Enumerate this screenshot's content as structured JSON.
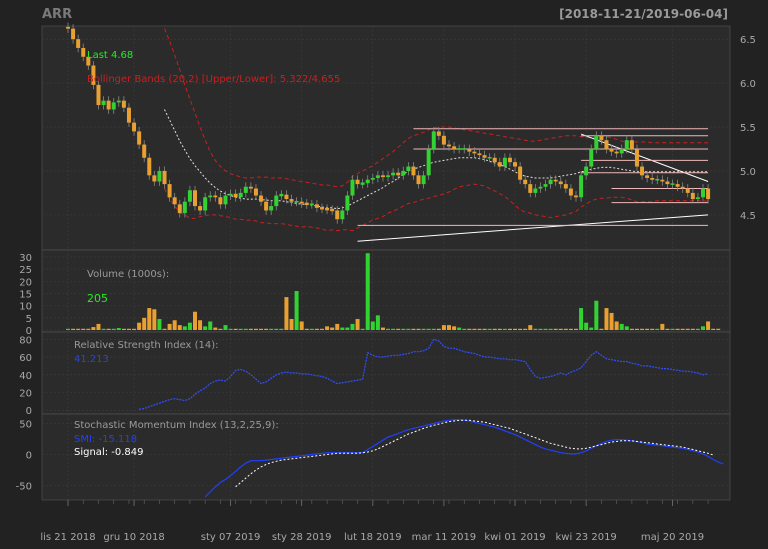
{
  "header": {
    "symbol": "ARR",
    "date_range": "[2018-11-21/2019-06-04]"
  },
  "colors": {
    "background": "#222222",
    "panel": "#2b2b2b",
    "grid": "#3c3c3c",
    "axis_text": "#a8a8a8",
    "candle_up": "#32d232",
    "candle_down": "#e8a030",
    "bollinger": "#cc1f1f",
    "sma": "#e0e0e0",
    "rsi": "#3050ff",
    "smi": "#2040ff",
    "signal": "#ffffff",
    "last_label": "#22ee22",
    "support_lines": "#f0b8b8"
  },
  "chart_data": [
    {
      "type": "candlestick",
      "panel": "price",
      "legend": {
        "last": "Last 4.68",
        "bollinger": "Bollinger Bands (20,2) [Upper/Lower]: 5.322/4.655"
      },
      "y_ticks": [
        "6.5",
        "6.0",
        "5.5",
        "5.0",
        "4.5"
      ],
      "ylim": [
        4.1,
        6.65
      ],
      "x_labels": [
        "lis 21 2018",
        "gru 10 2018",
        "sty 07 2019",
        "sty 28 2019",
        "lut 18 2019",
        "mar 11 2019",
        "kwi 01 2019",
        "kwi 23 2019",
        "maj 20 2019"
      ],
      "x_label_index": [
        0,
        13,
        32,
        46,
        60,
        74,
        88,
        102,
        119
      ],
      "closes": [
        6.62,
        6.5,
        6.4,
        6.3,
        6.2,
        5.98,
        5.75,
        5.8,
        5.7,
        5.78,
        5.8,
        5.72,
        5.55,
        5.45,
        5.3,
        5.15,
        4.95,
        4.88,
        5.0,
        4.85,
        4.7,
        4.62,
        4.52,
        4.65,
        4.78,
        4.6,
        4.55,
        4.7,
        4.72,
        4.7,
        4.62,
        4.72,
        4.74,
        4.7,
        4.75,
        4.82,
        4.8,
        4.72,
        4.65,
        4.55,
        4.6,
        4.72,
        4.73,
        4.68,
        4.65,
        4.65,
        4.63,
        4.62,
        4.62,
        4.58,
        4.57,
        4.56,
        4.55,
        4.45,
        4.55,
        4.72,
        4.9,
        4.85,
        4.86,
        4.9,
        4.92,
        4.95,
        4.93,
        4.95,
        4.98,
        4.95,
        5.0,
        5.05,
        4.95,
        4.85,
        4.95,
        5.25,
        5.45,
        5.4,
        5.3,
        5.28,
        5.25,
        5.25,
        5.25,
        5.22,
        5.2,
        5.18,
        5.15,
        5.15,
        5.1,
        5.05,
        5.15,
        5.1,
        5.05,
        4.9,
        4.85,
        4.75,
        4.8,
        4.82,
        4.85,
        4.9,
        4.88,
        4.85,
        4.8,
        4.72,
        4.7,
        4.95,
        5.05,
        5.25,
        5.4,
        5.35,
        5.25,
        5.22,
        5.2,
        5.25,
        5.35,
        5.25,
        5.05,
        4.95,
        4.92,
        4.9,
        4.9,
        4.88,
        4.85,
        4.85,
        4.82,
        4.8,
        4.75,
        4.68,
        4.7,
        4.8,
        4.68
      ],
      "bollinger_upper": [
        null,
        null,
        null,
        null,
        null,
        null,
        null,
        null,
        null,
        null,
        null,
        null,
        null,
        null,
        null,
        null,
        null,
        null,
        null,
        6.62,
        6.48,
        6.32,
        6.15,
        5.98,
        5.82,
        5.66,
        5.5,
        5.35,
        5.22,
        5.12,
        5.05,
        5.0,
        4.97,
        4.95,
        4.93,
        4.92,
        4.92,
        4.93,
        4.93,
        4.93,
        4.92,
        4.92,
        4.92,
        4.91,
        4.9,
        4.89,
        4.88,
        4.87,
        4.86,
        4.85,
        4.84,
        4.84,
        4.83,
        4.82,
        4.83,
        4.87,
        4.94,
        4.97,
        5.0,
        5.03,
        5.06,
        5.1,
        5.14,
        5.18,
        5.22,
        5.27,
        5.32,
        5.37,
        5.4,
        5.42,
        5.44,
        5.47,
        5.49,
        5.5,
        5.5,
        5.5,
        5.49,
        5.48,
        5.47,
        5.46,
        5.45,
        5.44,
        5.43,
        5.42,
        5.41,
        5.4,
        5.39,
        5.38,
        5.37,
        5.36,
        5.35,
        5.34,
        5.34,
        5.35,
        5.36,
        5.37,
        5.38,
        5.39,
        5.4,
        5.4,
        5.4,
        5.39,
        5.38,
        5.38,
        5.38,
        5.39,
        5.39,
        5.38,
        5.36,
        5.34,
        5.33,
        5.33,
        5.33,
        5.33,
        5.33,
        5.32,
        5.32,
        5.32,
        5.32,
        5.32,
        5.32,
        5.32,
        5.32,
        5.32,
        5.32,
        5.32,
        5.322
      ],
      "sma20": [
        null,
        null,
        null,
        null,
        null,
        null,
        null,
        null,
        null,
        null,
        null,
        null,
        null,
        null,
        null,
        null,
        null,
        null,
        null,
        5.7,
        5.58,
        5.46,
        5.34,
        5.24,
        5.14,
        5.06,
        4.99,
        4.92,
        4.86,
        4.81,
        4.77,
        4.74,
        4.72,
        4.7,
        4.69,
        4.68,
        4.68,
        4.68,
        4.67,
        4.67,
        4.66,
        4.66,
        4.66,
        4.65,
        4.64,
        4.63,
        4.62,
        4.62,
        4.61,
        4.6,
        4.59,
        4.58,
        4.58,
        4.57,
        4.58,
        4.6,
        4.63,
        4.66,
        4.69,
        4.72,
        4.75,
        4.78,
        4.81,
        4.85,
        4.88,
        4.92,
        4.96,
        5.0,
        5.02,
        5.04,
        5.06,
        5.08,
        5.1,
        5.11,
        5.12,
        5.13,
        5.14,
        5.15,
        5.15,
        5.15,
        5.15,
        5.14,
        5.13,
        5.11,
        5.09,
        5.07,
        5.05,
        5.02,
        4.99,
        4.96,
        4.94,
        4.93,
        4.92,
        4.92,
        4.92,
        4.92,
        4.93,
        4.94,
        4.95,
        4.96,
        4.97,
        4.99,
        5.0,
        5.02,
        5.03,
        5.04,
        5.04,
        5.04,
        5.03,
        5.02,
        5.01,
        5.0,
        4.99,
        4.99,
        4.99,
        4.99,
        4.99,
        4.99,
        4.99,
        4.99,
        4.99,
        4.99,
        4.99,
        4.99,
        4.99,
        4.99,
        4.99
      ],
      "bollinger_lower": [
        null,
        null,
        null,
        null,
        null,
        null,
        null,
        null,
        null,
        null,
        null,
        null,
        null,
        null,
        null,
        null,
        null,
        null,
        null,
        4.8,
        4.68,
        4.6,
        4.53,
        4.5,
        4.46,
        4.46,
        4.48,
        4.49,
        4.5,
        4.5,
        4.49,
        4.48,
        4.47,
        4.45,
        4.45,
        4.44,
        4.44,
        4.43,
        4.41,
        4.41,
        4.4,
        4.4,
        4.4,
        4.39,
        4.38,
        4.37,
        4.36,
        4.37,
        4.36,
        4.35,
        4.34,
        4.32,
        4.33,
        4.32,
        4.33,
        4.33,
        4.32,
        4.35,
        4.38,
        4.41,
        4.44,
        4.46,
        4.48,
        4.52,
        4.54,
        4.57,
        4.6,
        4.63,
        4.64,
        4.66,
        4.68,
        4.69,
        4.71,
        4.72,
        4.74,
        4.76,
        4.79,
        4.82,
        4.83,
        4.84,
        4.85,
        4.84,
        4.83,
        4.8,
        4.77,
        4.74,
        4.71,
        4.66,
        4.61,
        4.56,
        4.53,
        4.52,
        4.5,
        4.49,
        4.48,
        4.47,
        4.48,
        4.49,
        4.5,
        4.52,
        4.54,
        4.59,
        4.62,
        4.66,
        4.68,
        4.69,
        4.69,
        4.7,
        4.7,
        4.7,
        4.69,
        4.67,
        4.65,
        4.65,
        4.65,
        4.65,
        4.66,
        4.66,
        4.66,
        4.66,
        4.66,
        4.66,
        4.66,
        4.66,
        4.66,
        4.66,
        4.655
      ],
      "support_lines": [
        {
          "from": [
            57,
            4.2
          ],
          "to": [
            126,
            4.5
          ],
          "color": "#ffffff"
        },
        {
          "from": [
            57,
            4.38
          ],
          "to": [
            126,
            4.38
          ],
          "color": "#f0b8b8"
        },
        {
          "from": [
            101,
            5.42
          ],
          "to": [
            126,
            4.88
          ],
          "color": "#ffffff"
        },
        {
          "from": [
            68,
            5.48
          ],
          "to": [
            126,
            5.48
          ],
          "color": "#f0b8b8"
        },
        {
          "from": [
            101,
            5.4
          ],
          "to": [
            126,
            5.4
          ],
          "color": "#f0b8b8"
        },
        {
          "from": [
            68,
            5.25
          ],
          "to": [
            126,
            5.25
          ],
          "color": "#f0b8b8"
        },
        {
          "from": [
            101,
            5.12
          ],
          "to": [
            126,
            5.12
          ],
          "color": "#f0b8b8"
        },
        {
          "from": [
            101,
            4.98
          ],
          "to": [
            126,
            4.98
          ],
          "color": "#f0b8b8"
        },
        {
          "from": [
            107,
            4.8
          ],
          "to": [
            126,
            4.8
          ],
          "color": "#f0b8b8"
        },
        {
          "from": [
            107,
            4.64
          ],
          "to": [
            126,
            4.64
          ],
          "color": "#f0b8b8"
        }
      ]
    },
    {
      "type": "bar",
      "panel": "volume",
      "label": "Volume (1000s):",
      "last_value": "205",
      "y_ticks": [
        "30",
        "25",
        "20",
        "15",
        "10",
        "5",
        "0"
      ],
      "ylim": [
        0,
        32
      ],
      "values": [
        0.5,
        0.5,
        0.5,
        0.5,
        0.5,
        1.2,
        2.5,
        0.5,
        0.5,
        0.5,
        0.8,
        0.5,
        0.5,
        0.5,
        3.0,
        5.0,
        9.0,
        8.5,
        4.5,
        0.5,
        2.5,
        4.0,
        2.0,
        1.5,
        3.0,
        7.5,
        4.0,
        1.5,
        3.5,
        1.0,
        0.5,
        2.0,
        0.5,
        0.5,
        0.5,
        0.5,
        0.5,
        0.5,
        0.5,
        0.5,
        0.5,
        0.5,
        0.5,
        13.5,
        4.5,
        16.0,
        3.5,
        0.5,
        0.5,
        0.5,
        0.5,
        1.5,
        1.0,
        2.5,
        1.0,
        1.0,
        2.5,
        4.5,
        0.5,
        31.5,
        3.5,
        6.0,
        1.0,
        0.5,
        0.5,
        0.5,
        0.5,
        0.5,
        0.5,
        0.5,
        0.5,
        0.5,
        0.5,
        0.5,
        2.0,
        2.0,
        1.5,
        1.0,
        0.5,
        0.5,
        0.5,
        0.5,
        0.5,
        0.5,
        0.5,
        0.5,
        0.5,
        0.5,
        0.5,
        0.5,
        0.5,
        2.0,
        0.5,
        0.5,
        0.5,
        0.5,
        0.5,
        0.5,
        0.5,
        0.5,
        0.5,
        9.0,
        3.0,
        1.0,
        12.0,
        0.5,
        9.0,
        7.0,
        3.5,
        2.5,
        1.5,
        0.5,
        0.5,
        0.5,
        0.5,
        0.5,
        0.5,
        2.5,
        0.5,
        0.5,
        0.5,
        0.5,
        0.5,
        0.5,
        0.5,
        1.5,
        3.5,
        0.5,
        0.5
      ]
    },
    {
      "type": "line",
      "panel": "rsi",
      "label": "Relative Strength Index (14):",
      "last_value": "41.213",
      "y_ticks": [
        "80",
        "60",
        "40",
        "20",
        "0"
      ],
      "ylim": [
        -2,
        86
      ],
      "values": [
        null,
        null,
        null,
        null,
        null,
        null,
        null,
        null,
        null,
        null,
        null,
        null,
        null,
        null,
        1,
        2,
        4,
        6,
        8,
        10,
        12,
        13,
        12,
        11,
        13,
        18,
        22,
        25,
        30,
        33,
        34,
        33,
        38,
        45,
        46,
        44,
        40,
        35,
        30,
        32,
        36,
        40,
        42,
        43,
        42,
        42,
        41,
        41,
        40,
        39,
        38,
        36,
        33,
        30,
        31,
        32,
        33,
        34,
        35,
        65,
        62,
        60,
        60,
        61,
        62,
        62,
        63,
        64,
        66,
        66,
        67,
        70,
        80,
        78,
        72,
        70,
        70,
        68,
        66,
        65,
        64,
        62,
        60,
        60,
        59,
        58,
        58,
        57,
        57,
        56,
        55,
        46,
        38,
        36,
        37,
        38,
        40,
        42,
        40,
        43,
        45,
        48,
        55,
        62,
        66,
        62,
        58,
        57,
        56,
        55,
        55,
        53,
        52,
        50,
        50,
        49,
        48,
        47,
        47,
        46,
        45,
        44,
        44,
        43,
        42,
        40,
        41.2
      ]
    },
    {
      "type": "line",
      "panel": "smi",
      "label": "Stochastic Momentum Index (13,2,25,9):",
      "smi_label": "SMI: -15.118",
      "signal_label": "Signal: -0.849",
      "y_ticks": [
        "50",
        "0",
        "-50"
      ],
      "ylim": [
        -70,
        62
      ],
      "smi": [
        null,
        null,
        null,
        null,
        null,
        null,
        null,
        null,
        null,
        null,
        null,
        null,
        null,
        null,
        null,
        null,
        null,
        null,
        null,
        null,
        null,
        null,
        null,
        null,
        null,
        null,
        null,
        -68,
        -60,
        -52,
        -45,
        -40,
        -34,
        -27,
        -20,
        -14,
        -10,
        -10,
        -10,
        -9,
        -8,
        -7,
        -6,
        -5,
        -4,
        -3,
        -2,
        -1,
        0,
        1,
        2,
        3,
        3,
        3,
        3,
        3,
        3,
        3,
        3,
        8,
        13,
        18,
        23,
        28,
        31,
        34,
        37,
        40,
        42,
        44,
        46,
        48,
        50,
        52,
        54,
        55,
        56,
        56,
        55,
        54,
        52,
        50,
        48,
        46,
        44,
        41,
        38,
        35,
        32,
        28,
        24,
        20,
        16,
        12,
        9,
        7,
        5,
        3,
        2,
        1,
        1,
        3,
        6,
        10,
        14,
        18,
        21,
        23,
        24,
        24,
        23,
        22,
        21,
        19,
        17,
        16,
        15,
        14,
        13,
        12,
        11,
        10,
        8,
        6,
        4,
        1,
        -3,
        -8,
        -12,
        -15.1
      ],
      "signal": [
        null,
        null,
        null,
        null,
        null,
        null,
        null,
        null,
        null,
        null,
        null,
        null,
        null,
        null,
        null,
        null,
        null,
        null,
        null,
        null,
        null,
        null,
        null,
        null,
        null,
        null,
        null,
        null,
        null,
        null,
        null,
        null,
        null,
        -52,
        -45,
        -38,
        -31,
        -25,
        -20,
        -16,
        -13,
        -11,
        -9,
        -8,
        -7,
        -6,
        -5,
        -4,
        -3,
        -2,
        -1,
        0,
        1,
        2,
        2,
        2,
        2,
        2,
        3,
        4,
        6,
        9,
        13,
        17,
        21,
        25,
        29,
        33,
        36,
        39,
        42,
        45,
        47,
        49,
        51,
        53,
        54,
        55,
        55,
        55,
        54,
        53,
        52,
        50,
        48,
        46,
        44,
        42,
        39,
        36,
        33,
        30,
        27,
        24,
        21,
        18,
        16,
        14,
        12,
        10,
        9,
        9,
        10,
        12,
        14,
        16,
        18,
        20,
        21,
        22,
        22,
        22,
        21,
        20,
        19,
        18,
        17,
        16,
        15,
        14,
        13,
        12,
        10,
        8,
        6,
        4,
        2,
        -0.85
      ]
    }
  ]
}
